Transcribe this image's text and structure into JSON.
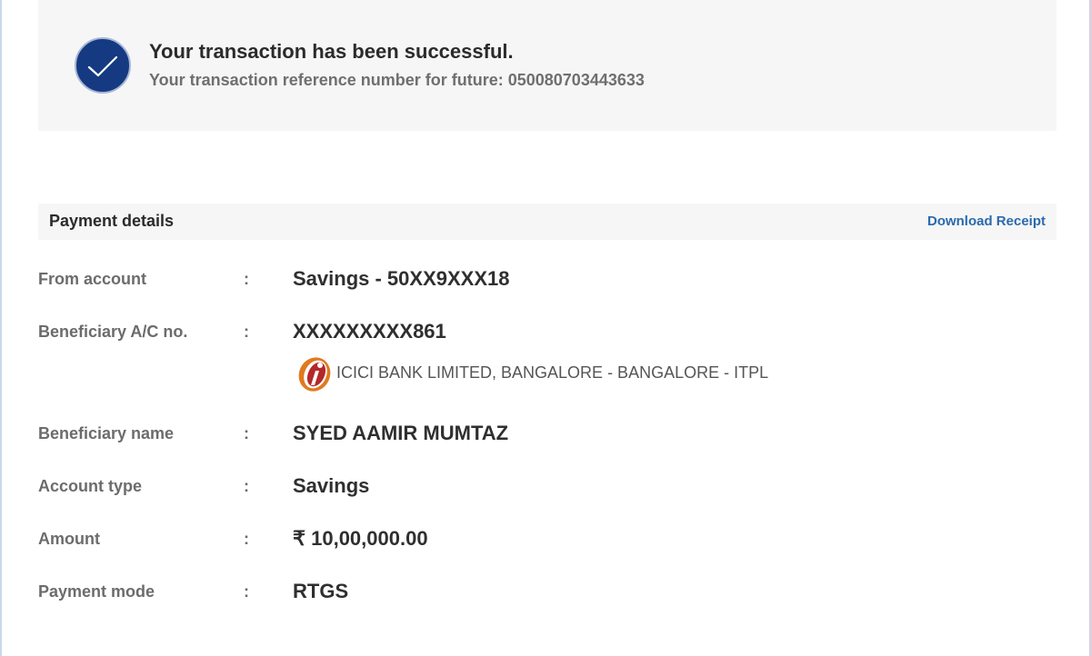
{
  "success": {
    "title": "Your transaction has been successful.",
    "reference_text": "Your transaction reference number for future: 050080703443633",
    "icon": "check-circle-icon",
    "icon_color": "#153a82"
  },
  "details": {
    "title": "Payment details",
    "download_label": "Download Receipt",
    "link_color": "#2a6aad",
    "colon": ":",
    "rows": {
      "from_account": {
        "label": "From account",
        "value": "Savings - 50XX9XXX18"
      },
      "beneficiary_ac": {
        "label": "Beneficiary A/C no.",
        "value": "XXXXXXXXX861"
      },
      "bank": {
        "text": "ICICI BANK LIMITED, BANGALORE - BANGALORE - ITPL",
        "logo": "icici-bank-logo"
      },
      "beneficiary_name": {
        "label": "Beneficiary name",
        "value": "SYED AAMIR MUMTAZ"
      },
      "account_type": {
        "label": "Account type",
        "value": "Savings"
      },
      "amount": {
        "label": "Amount",
        "value": "₹ 10,00,000.00"
      },
      "payment_mode": {
        "label": "Payment mode",
        "value": "RTGS"
      }
    }
  }
}
